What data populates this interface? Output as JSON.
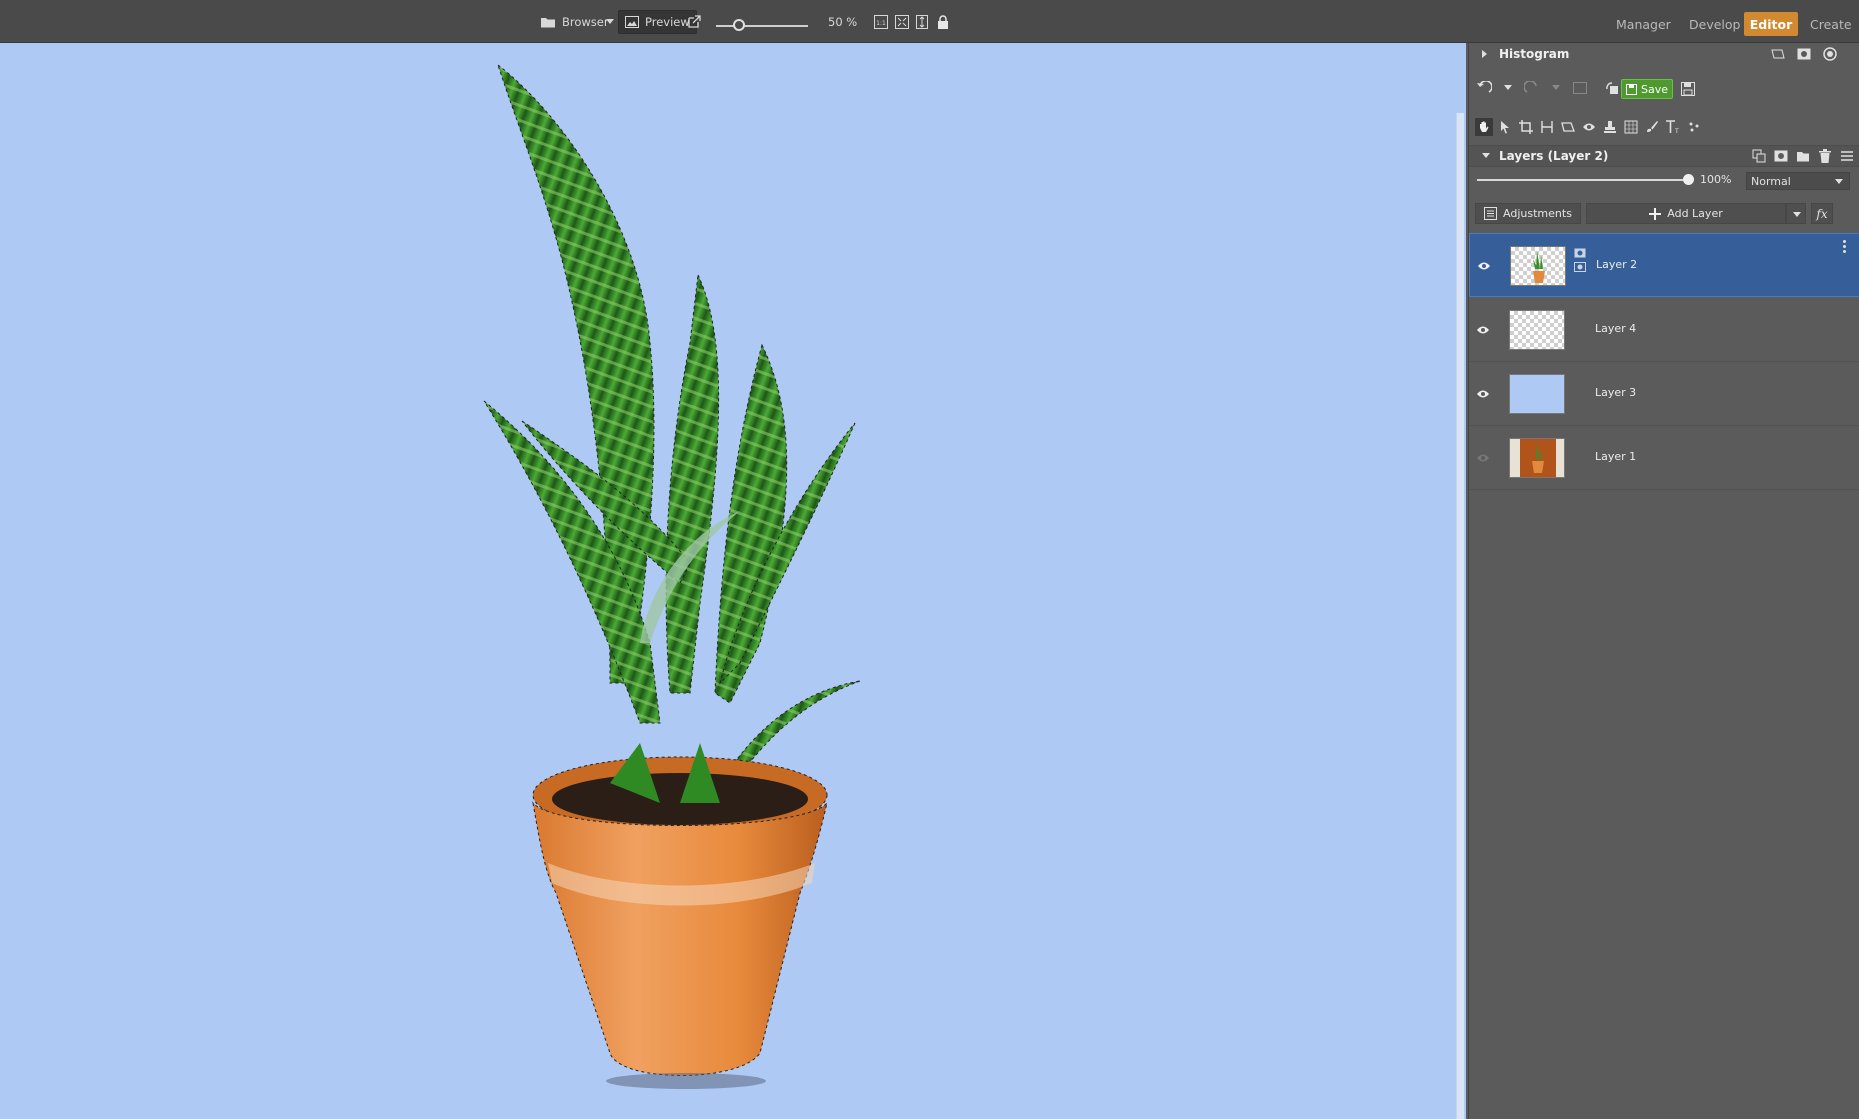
{
  "topbar": {
    "browser_label": "Browser",
    "preview_label": "Preview",
    "zoom_level": "50 %",
    "zoom_fraction": 0.25,
    "modes": [
      {
        "label": "Manager",
        "active": false
      },
      {
        "label": "Develop",
        "active": false
      },
      {
        "label": "Editor",
        "active": true
      },
      {
        "label": "Create",
        "active": false
      }
    ]
  },
  "panel": {
    "histogram_title": "Histogram",
    "save_label": "Save",
    "layers_title": "Layers (Layer 2)",
    "opacity_label": "100%",
    "opacity_fraction": 1.0,
    "blend_mode": "Normal",
    "adjustments_label": "Adjustments",
    "add_layer_label": "Add Layer",
    "fx_label": "fx",
    "layers": [
      {
        "name": "Layer 2",
        "visible": true,
        "selected": true,
        "thumb": "plant"
      },
      {
        "name": "Layer 4",
        "visible": true,
        "selected": false,
        "thumb": "empty"
      },
      {
        "name": "Layer 3",
        "visible": true,
        "selected": false,
        "thumb": "blue"
      },
      {
        "name": "Layer 1",
        "visible": false,
        "selected": false,
        "thumb": "photo"
      }
    ]
  },
  "colors": {
    "accent": "#d2892f",
    "canvas_bg": "#afc9f5",
    "selection": "#365f99",
    "save_green": "#4e9a2f"
  }
}
